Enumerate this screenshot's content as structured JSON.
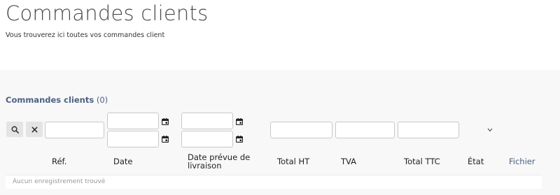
{
  "page": {
    "title": "Commandes clients",
    "subtitle": "Vous trouverez ici toutes vos commandes client"
  },
  "list": {
    "title": "Commandes clients",
    "count": "(0)",
    "empty_message": "Aucun enregistrement trouvé"
  },
  "filters": {
    "search_icon": "search-icon",
    "reset_icon": "close-icon",
    "calendar_icon": "calendar-icon",
    "status_select_icon": "chevron-down-icon",
    "ref_value": "",
    "date_start_value": "",
    "date_end_value": "",
    "delivery_start_value": "",
    "delivery_end_value": "",
    "total_ht_value": "",
    "tva_value": "",
    "total_ttc_value": ""
  },
  "columns": {
    "ref": "Réf.",
    "date": "Date",
    "delivery_line1": "Date prévue de",
    "delivery_line2": "livraison",
    "total_ht": "Total HT",
    "tva": "TVA",
    "total_ttc": "Total TTC",
    "status": "État",
    "file": "Fichier"
  },
  "colors": {
    "accent": "#4d5f82",
    "band": "#f8f8f8",
    "empty_text": "#999999"
  }
}
